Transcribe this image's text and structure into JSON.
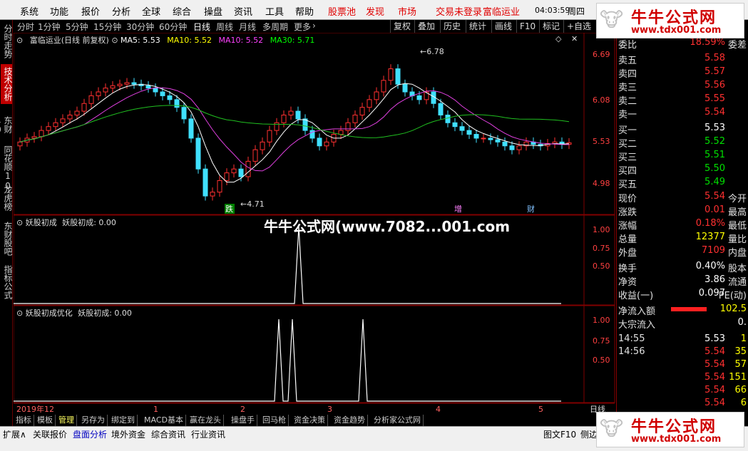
{
  "menubar": {
    "items": [
      "系统",
      "功能",
      "报价",
      "分析",
      "全球",
      "综合",
      "操盘",
      "资讯",
      "工具",
      "帮助"
    ],
    "red_items": [
      "股票池",
      "发现",
      "市场",
      "交易未登录",
      "富临运业"
    ],
    "clock": "04:03:59",
    "weekday": "周四"
  },
  "timeframes": [
    "分时",
    "1分钟",
    "5分钟",
    "15分钟",
    "30分钟",
    "60分钟",
    "日线",
    "周线",
    "月线",
    "多周期",
    "更多"
  ],
  "active_timeframe": "日线",
  "toolbar_buttons": [
    "复权",
    "叠加",
    "历史",
    "统计",
    "画线",
    "F10",
    "标记",
    "+自选"
  ],
  "left_tabs": [
    "分时走势",
    "技术分析",
    "东财10",
    "同花顺10",
    "龙虎榜",
    "东财股吧",
    "指标公式"
  ],
  "active_left_tab": "技术分析",
  "main_chart": {
    "title": "富临运业(日线 前复权)",
    "ma": [
      {
        "label": "MA5: 5.53",
        "color": "#ffffff"
      },
      {
        "label": "MA10: 5.52",
        "color": "#ffff00"
      },
      {
        "label": "MA10: 5.52",
        "color": "#ff40ff"
      },
      {
        "label": "MA30: 5.71",
        "color": "#00ff00"
      }
    ],
    "price_ticks": [
      "6.69",
      "6.08",
      "5.53",
      "4.98"
    ],
    "high_label": "6.78",
    "low_label": "4.71",
    "markers": [
      "跌",
      "增",
      "财"
    ]
  },
  "indicator1": {
    "title": "妖股初成",
    "value": "妖股初成: 0.00",
    "ticks": [
      "1.00",
      "0.75",
      "0.50"
    ]
  },
  "indicator2": {
    "title": "妖股初成优化",
    "value": "妖股初成: 0.00",
    "ticks": [
      "1.00",
      "0.75",
      "0.50"
    ]
  },
  "date_axis": [
    "2019年12",
    "1",
    "2",
    "3",
    "4",
    "5"
  ],
  "date_axis_right": "日线",
  "bottom_tabs": [
    "指标",
    "模板",
    "管理",
    "另存为",
    "绑定到",
    "MACD基本",
    "赢在龙头",
    "操盘手",
    "回马枪",
    "资金决策",
    "资金趋势",
    "分析家公式网"
  ],
  "bottom_tabs2": [
    "扩展∧",
    "关联报价",
    "盘面分析",
    "境外资金",
    "综合资讯",
    "行业资讯"
  ],
  "status_right": [
    "图文F10",
    "侧边"
  ],
  "quote": {
    "weibi_label": "委比",
    "weibi_value": "18.59%",
    "weicha_label": "委差",
    "asks": [
      {
        "label": "卖五",
        "price": "5.58"
      },
      {
        "label": "卖四",
        "price": "5.57"
      },
      {
        "label": "卖三",
        "price": "5.56"
      },
      {
        "label": "卖二",
        "price": "5.55"
      },
      {
        "label": "卖一",
        "price": "5.54"
      }
    ],
    "bids": [
      {
        "label": "买一",
        "price": "5.53"
      },
      {
        "label": "买二",
        "price": "5.52"
      },
      {
        "label": "买三",
        "price": "5.51"
      },
      {
        "label": "买四",
        "price": "5.50"
      },
      {
        "label": "买五",
        "price": "5.49"
      }
    ],
    "stats": [
      {
        "label": "现价",
        "value": "5.54",
        "label2": "今开"
      },
      {
        "label": "涨跌",
        "value": "0.01",
        "label2": "最高"
      },
      {
        "label": "涨幅",
        "value": "0.18%",
        "label2": "最低"
      },
      {
        "label": "总量",
        "value": "12377",
        "label2": "量比"
      },
      {
        "label": "外盘",
        "value": "7109",
        "label2": "内盘"
      }
    ],
    "stats2": [
      {
        "label": "换手",
        "value": "0.40%",
        "label2": "股本"
      },
      {
        "label": "净资",
        "value": "3.86",
        "label2": "流通"
      },
      {
        "label": "收益(一)",
        "value": "0.097",
        "label2": "PE(动)"
      }
    ],
    "netflow_label": "净流入额",
    "netflow_value": "102.5",
    "bigflow_label": "大宗流入",
    "bigflow_value": "0.",
    "ticks": [
      {
        "time": "14:55",
        "price": "5.53",
        "vol": "1"
      },
      {
        "time": "14:56",
        "price": "5.54",
        "vol": "35"
      },
      {
        "time": "",
        "price": "5.54",
        "vol": "57"
      },
      {
        "time": "",
        "price": "5.54",
        "vol": "151"
      },
      {
        "time": "",
        "price": "5.54",
        "vol": "66"
      },
      {
        "time": "",
        "price": "5.54",
        "vol": "6"
      }
    ]
  },
  "watermark": {
    "title": "牛牛公式网",
    "url": "www.tdx001.com",
    "overlay": "牛牛公式网(www.7082...001.com"
  }
}
